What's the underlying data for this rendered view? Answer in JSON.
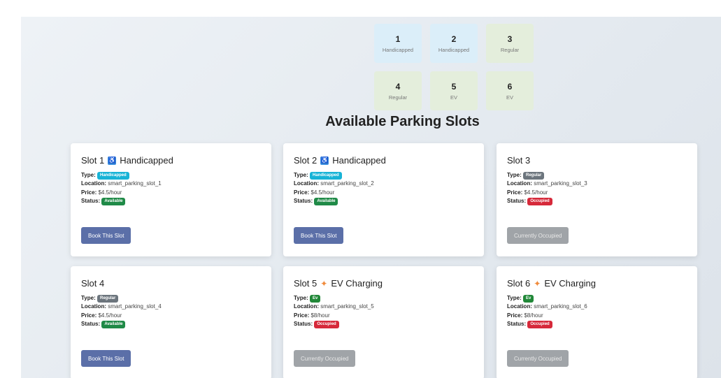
{
  "mini_slots": [
    {
      "num": "1",
      "label": "Handicapped",
      "kind": "handicapped"
    },
    {
      "num": "2",
      "label": "Handicapped",
      "kind": "handicapped"
    },
    {
      "num": "3",
      "label": "Regular",
      "kind": "regular"
    },
    {
      "num": "4",
      "label": "Regular",
      "kind": "regular"
    },
    {
      "num": "5",
      "label": "EV",
      "kind": "ev"
    },
    {
      "num": "6",
      "label": "EV",
      "kind": "ev"
    }
  ],
  "section_title": "Available Parking Slots",
  "labels": {
    "type": "Type:",
    "location": "Location:",
    "price": "Price:",
    "status": "Status:"
  },
  "slots": [
    {
      "title": "Slot 1",
      "suffix": "Handicapped",
      "icon": "handicapped-icon",
      "type": "Handicapped",
      "location": "smart_parking_slot_1",
      "price": "$4.5/hour",
      "status": "Available",
      "button": "Book This Slot"
    },
    {
      "title": "Slot 2",
      "suffix": "Handicapped",
      "icon": "handicapped-icon",
      "type": "Handicapped",
      "location": "smart_parking_slot_2",
      "price": "$4.5/hour",
      "status": "Available",
      "button": "Book This Slot"
    },
    {
      "title": "Slot 3",
      "suffix": "",
      "icon": "",
      "type": "Regular",
      "location": "smart_parking_slot_3",
      "price": "$4.5/hour",
      "status": "Occupied",
      "button": "Currently Occupied"
    },
    {
      "title": "Slot 4",
      "suffix": "",
      "icon": "",
      "type": "Regular",
      "location": "smart_parking_slot_4",
      "price": "$4.5/hour",
      "status": "Available",
      "button": "Book This Slot"
    },
    {
      "title": "Slot 5",
      "suffix": "EV Charging",
      "icon": "ev-charging-icon",
      "type": "Ev",
      "location": "smart_parking_slot_5",
      "price": "$8/hour",
      "status": "Occupied",
      "button": "Currently Occupied"
    },
    {
      "title": "Slot 6",
      "suffix": "EV Charging",
      "icon": "ev-charging-icon",
      "type": "Ev",
      "location": "smart_parking_slot_6",
      "price": "$8/hour",
      "status": "Occupied",
      "button": "Currently Occupied"
    }
  ]
}
